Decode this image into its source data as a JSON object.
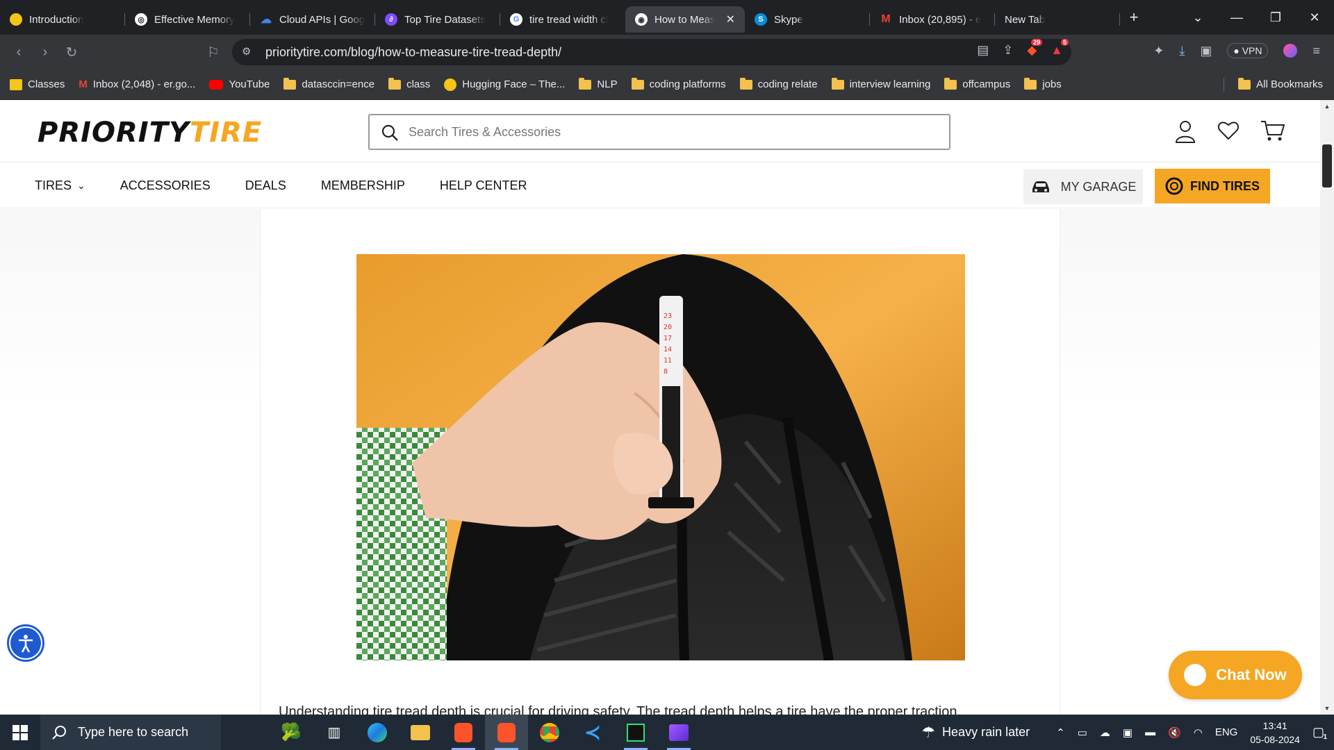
{
  "browser": {
    "tabs": [
      {
        "title": "Introduction",
        "color": "#f5c518",
        "glyph": "🤗"
      },
      {
        "title": "Effective Memory",
        "color": "#ffffff",
        "glyph": "◎"
      },
      {
        "title": "Cloud APIs | Goog",
        "color": "#4285f4",
        "glyph": "☁"
      },
      {
        "title": "Top Tire Datasets",
        "color": "#7b4dff",
        "glyph": "∂"
      },
      {
        "title": "tire tread width cl",
        "color": "#ffffff",
        "glyph": "G"
      },
      {
        "title": "How to Meas",
        "color": "#ffffff",
        "glyph": "◉"
      },
      {
        "title": "Skype",
        "color": "#0a8ddb",
        "glyph": "S"
      },
      {
        "title": "Inbox (20,895) - e",
        "color": "#ea4335",
        "glyph": "M"
      },
      {
        "title": "New Tab",
        "color": "",
        "glyph": ""
      }
    ],
    "url": "prioritytire.com/blog/how-to-measure-tire-tread-depth/",
    "bookmarks": [
      "Classes",
      "Inbox (2,048) - er.go...",
      "YouTube",
      "datasccin=ence",
      "class",
      "Hugging Face – The...",
      "NLP",
      "coding platforms",
      "coding relate",
      "interview learning",
      "offcampus",
      "jobs"
    ],
    "all_bookmarks": "All Bookmarks",
    "vpn": "VPN",
    "brave_badge": "29",
    "alert_badge": "5"
  },
  "site": {
    "logo_primary": "PRIORITY",
    "logo_accent": "TIRE",
    "search_placeholder": "Search Tires & Accessories",
    "nav": [
      "TIRES",
      "ACCESSORIES",
      "DEALS",
      "MEMBERSHIP",
      "HELP CENTER"
    ],
    "garage": "MY GARAGE",
    "find_tires": "FIND TIRES",
    "paragraph": "Understanding tire tread depth is crucial for driving safety. The tread depth helps a tire have the proper traction,",
    "chat": "Chat Now",
    "colors": {
      "accent": "#f5a623",
      "accessibility": "#1e5bd0"
    }
  },
  "gauge_marks": [
    "23",
    "20",
    "17",
    "14",
    "11",
    "8"
  ],
  "taskbar": {
    "search_placeholder": "Type here to search",
    "weather": "Heavy rain later",
    "lang": "ENG",
    "time": "13:41",
    "date": "05-08-2024",
    "notifications": "1"
  }
}
